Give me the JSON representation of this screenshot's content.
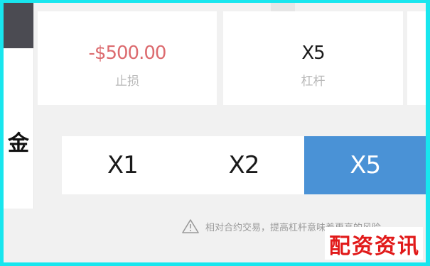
{
  "header": {
    "title": ""
  },
  "sidebar": {
    "label": "金"
  },
  "stats": [
    {
      "value": "-$500.00",
      "label": "止损",
      "value_color": "#dc6b6f"
    },
    {
      "value": "X5",
      "label": "杠杆",
      "value_color": "#1b1b1b"
    }
  ],
  "leverage": {
    "options": [
      "X1",
      "X2",
      "X5"
    ],
    "selected": "X5"
  },
  "notice": {
    "icon": "warning-icon",
    "text": "相对合约交易，提高杠杆意味着更高的风险"
  },
  "watermark": "配资资讯",
  "colors": {
    "accent": "#4a92d6",
    "frame": "#18e6ee",
    "watermark": "#e11919"
  }
}
